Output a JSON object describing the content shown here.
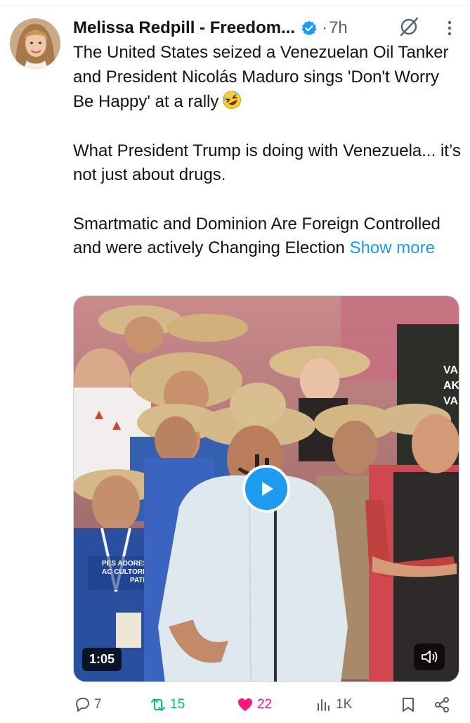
{
  "tweet": {
    "author": "Melissa Redpill - Freedom...",
    "separator": "·",
    "time": "7h",
    "paragraphs": [
      "The United States seized a Venezuelan Oil Tanker and President Nicolás Maduro sings 'Don't Worry Be Happy' at a rally",
      "What President Trump is doing with Venezuela... it’s not just about drugs.",
      "Smartmatic and Dominion Are Foreign Controlled and were actively Changing Election"
    ],
    "show_more": "Show more",
    "emoji": "rolling-on-floor-laughing-emoji"
  },
  "media": {
    "duration": "1:05",
    "sign_text": [
      "VA",
      "AK",
      "VAI"
    ],
    "lanyard_text": [
      "PES ADORES",
      "AC CULTORES",
      "PATRI"
    ]
  },
  "actions": {
    "replies": "7",
    "reposts": "15",
    "likes": "22",
    "views": "1K"
  },
  "colors": {
    "accent": "#1d9bf0",
    "repost": "#00ba7c",
    "like": "#f91880",
    "muted": "#536471"
  },
  "icons": [
    "verified-badge-icon",
    "grok-icon",
    "more-icon",
    "play-icon",
    "volume-icon",
    "reply-icon",
    "repost-icon",
    "like-icon",
    "views-icon",
    "bookmark-icon",
    "share-icon"
  ]
}
